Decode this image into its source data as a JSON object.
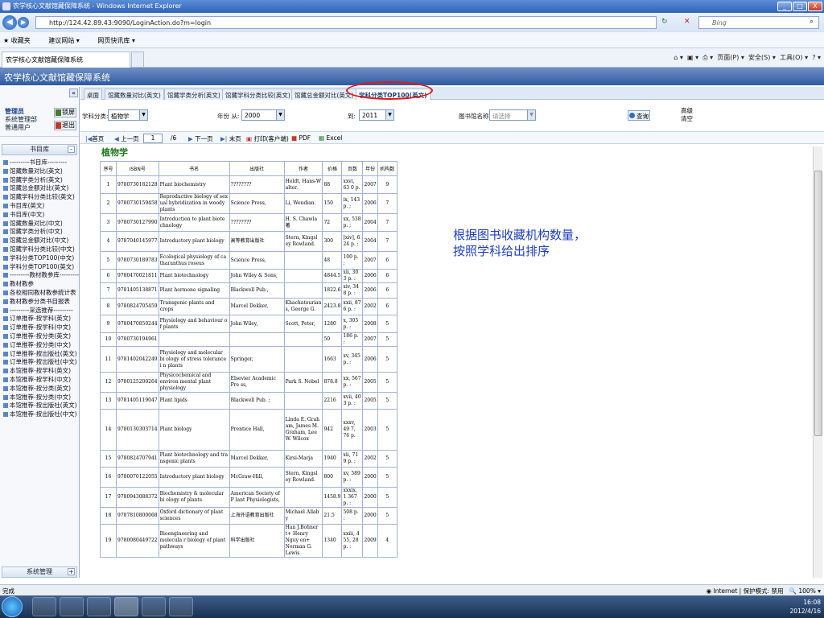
{
  "window": {
    "title": "农学核心文献馆藏保障系统 - Windows Internet Explorer",
    "min": "_",
    "max": "□",
    "close": "X"
  },
  "browser": {
    "url": "http://124.42.89.43:9090/LoginAction.do?m=login",
    "search_placeholder": "Bing",
    "favorites": [
      "收藏夹",
      "建议网站 ▾",
      "网页快讯库 ▾"
    ],
    "tab_title": "农学核心文献馆藏保障系统",
    "cmds": [
      "页面(P) ▾",
      "安全(S) ▾",
      "工具(O) ▾"
    ]
  },
  "app": {
    "title": "农学核心文献馆藏保障系统"
  },
  "sidebar": {
    "collapse": "«",
    "user_role": "管理员",
    "user_lines": [
      "系统管理部",
      "普通用户"
    ],
    "lock_label": "锁屏",
    "logout_label": "退出",
    "panel_title": "书目库",
    "panel_bottom": "系统管理",
    "items": [
      "---------书目库---------",
      "馆藏数量对比(英文)",
      "馆藏学类分析(英文)",
      "馆藏总金额对比(英文)",
      "馆藏学科分类比较(英文)",
      "书目库(英文)",
      "书目库(中文)",
      "馆藏数量对比(中文)",
      "馆藏学类分析(中文)",
      "馆藏总金额对比(中文)",
      "馆藏学科分类比较(中文)",
      "学科分类TOP100(中文)",
      "学科分类TOP100(英文)",
      "---------教材教参库---------",
      "教材教参",
      "各校相同教材教参统计表",
      "教材教参分类书目报表",
      "---------采选推荐---------",
      "订单推荐-按学科(英文)",
      "订单推荐-按学科(中文)",
      "订单推荐-按分类(英文)",
      "订单推荐-按分类(中文)",
      "订单推荐-按出版社(英文)",
      "订单推荐-按出版社(中文)",
      "本馆推荐-按学科(英文)",
      "本馆推荐-按学科(中文)",
      "本馆推荐-按分类(英文)",
      "本馆推荐-按分类(中文)",
      "本馆推荐-按出版社(英文)",
      "本馆推荐-按出版社(中文)"
    ]
  },
  "tabs": [
    "桌面",
    "馆藏数量对比(英文)",
    "馆藏学类分析(英文)",
    "馆藏学科分类比较(英文)",
    "馆藏总金额对比(英文)",
    "学科分类TOP100(英文)"
  ],
  "filters": {
    "subject_label": "学科分类:",
    "subject_value": "植物学",
    "year_label": "年份 从:",
    "year_from": "2000",
    "to_label": "到:",
    "year_to": "2011",
    "lib_label": "图书馆名称:",
    "lib_placeholder": "请选择",
    "query_label": "查询",
    "adv1": "高级",
    "adv2": "清空"
  },
  "pager": {
    "first": "首页",
    "prev": "上一页",
    "page": "1",
    "total": "/6",
    "next": "下一页",
    "last": "末页",
    "print": "打印(客户端)",
    "pdf": "PDF",
    "excel": "Excel"
  },
  "subject_title": "植物学",
  "table": {
    "headers": [
      "序号",
      "ISBN号",
      "书名",
      "出版社",
      "作者",
      "价格",
      "页数",
      "年份",
      "机构数"
    ],
    "rows": [
      [
        "1",
        "9780730182128",
        "Plant biochemistry",
        "????????",
        "Heldt, Hans-W alter.",
        "88",
        "xxvi, 63 0 p.",
        "2007",
        "9"
      ],
      [
        "2",
        "9780730159458",
        "Reproductive biology of sex ual hybridization in woody plants",
        "Science Press,",
        "Li, Wendian.",
        "150",
        "ix, 143 p. ;",
        "2006",
        "7"
      ],
      [
        "3",
        "9780730127990",
        "Introduction to plant biote chnology",
        "????????",
        "H. S. Chawla 著",
        "72",
        "xx, 538 p. ;",
        "2004",
        "7"
      ],
      [
        "4",
        "9787040145977",
        "Introductory plant biology",
        "高等教育出版社",
        "Stern, Kingsl ey Rowland.",
        "300",
        "[xiv], 6 24 p. :",
        "2004",
        "7"
      ],
      [
        "5",
        "9780730189783",
        "Ecological physiology of ca tharanthus roseus",
        "Science Press,",
        "",
        "48",
        "100 p. :",
        "2007",
        "6"
      ],
      [
        "6",
        "9780470021811",
        "Plant biotechnology",
        "John Wiley & Sons,",
        "",
        "4844.5",
        "xii, 30 3 p. :",
        "2006",
        "6"
      ],
      [
        "7",
        "9781405138871",
        "Plant hormone signaling",
        "Blackwell Pub.,",
        "",
        "1822.6",
        "xiv, 34 8 p. :",
        "2006",
        "6"
      ],
      [
        "8",
        "9780824705459",
        "Transgenic plants and crops",
        "Marcel Dekker,",
        "Khachatourian s, George G.",
        "2423.8",
        "xxii, 87 6 p. :",
        "2002",
        "6"
      ],
      [
        "9",
        "9780470850244",
        "Physiology and behaviour o f plants",
        "John Wiley,",
        "Scott, Peter,",
        "1280",
        "x, 305 p. :",
        "2008",
        "5"
      ],
      [
        "10",
        "9780730194961",
        "",
        "",
        "",
        "50",
        "186 p. :",
        "2007",
        "5"
      ],
      [
        "11",
        "9781402042249",
        "Physiology and molecular bi ology of stress tolerance i n plants",
        "Springer,",
        "",
        "1663",
        "xv, 345 p. :",
        "2006",
        "5"
      ],
      [
        "12",
        "9780125200264",
        "Physicochemical and environ mental plant physiology",
        "Elsevier Academic Pre ss,",
        "Park S. Nobel",
        "878.8",
        "xx, 567 p. :",
        "2005",
        "5"
      ],
      [
        "13",
        "9781405119047",
        "Plant lipids",
        "Blackwell Pub. ;",
        "",
        "2216",
        "xvii, 40 3 p. :",
        "2005",
        "5"
      ],
      [
        "14",
        "9780130303714",
        "Plant biology",
        "Prentice Hall,",
        "Linda E. Grah am, James M. Graham, Lee W. Wilcox",
        "942",
        "xxxv, 49 7, 76 p.",
        "2003",
        "5"
      ],
      [
        "15",
        "9780824707941",
        "Plant biotechnology and tra nsgenic plants",
        "Marcel Dekker,",
        "Kirsi-Marja",
        "1940",
        "xii, 71 9 p. :",
        "2002",
        "5"
      ],
      [
        "16",
        "9780070122055",
        "Introductory plant biology",
        "McGraw-Hill,",
        "Stern, Kingsl ey Rowland.",
        "800",
        "xv, 589 p. :",
        "2000",
        "5"
      ],
      [
        "17",
        "9780943088372",
        "Biochemistry & molecular bi ology of plants",
        "American Society of P lant Physiologists,",
        "",
        "1458.9",
        "xxxix, 1 367 p. :",
        "2000",
        "5"
      ],
      [
        "18",
        "9787810800068",
        "Oxford dictionary of plant sciences",
        "上海外语教育出版社",
        "Michael Allab y",
        "21.5",
        "508 p. :",
        "2000",
        "5"
      ],
      [
        "19",
        "9780080449722",
        "Bioengineering and molecula r biology of plant pathways",
        "科学出版社",
        "Han J.Bohner t+ Henry Nguy en+ Norman G. Lewis",
        "1340",
        "xxiii, 4 55, 28 p. :",
        "2009",
        "4"
      ]
    ]
  },
  "note": [
    "根据图书收藏机构数量，",
    "按照学科给出排序"
  ],
  "status": {
    "left": "完成",
    "zone": "Internet | 保护模式: 禁用",
    "zoom": "100%"
  },
  "taskbar": {
    "time": "16:08",
    "date": "2012/4/16"
  }
}
